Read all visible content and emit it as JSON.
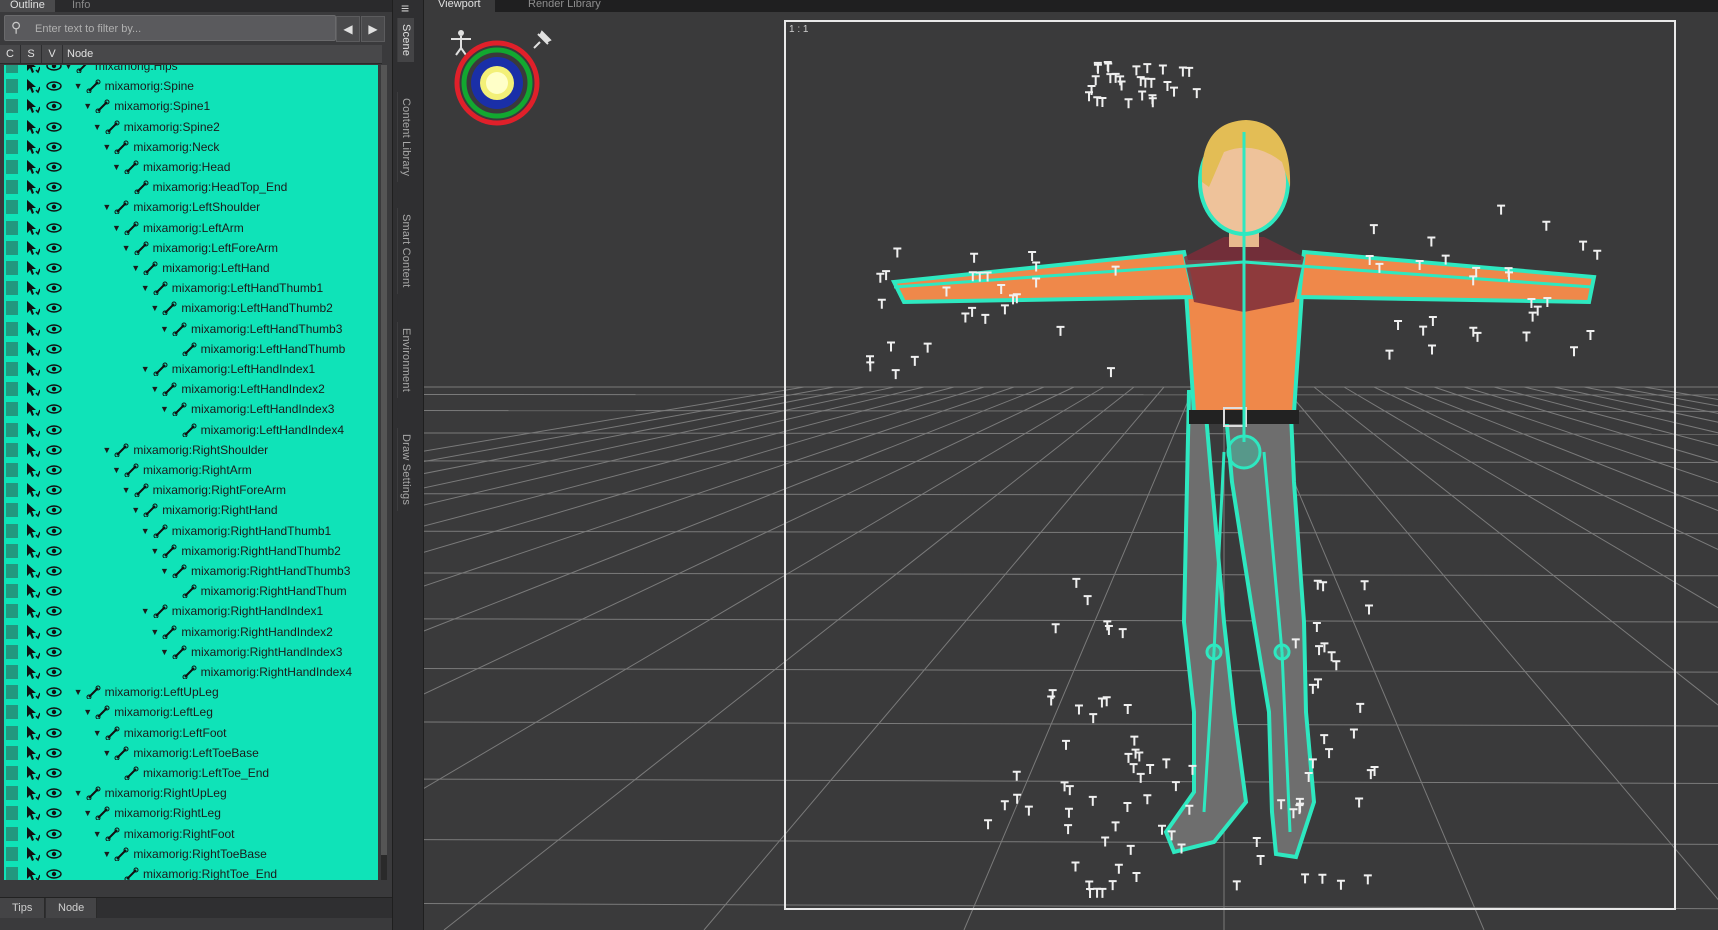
{
  "outline_panel": {
    "tabs": [
      {
        "label": "Outline",
        "active": true
      },
      {
        "label": "Info",
        "active": false
      }
    ],
    "filter": {
      "placeholder": "Enter text to filter by...",
      "value": ""
    },
    "nav_prev": "◀",
    "nav_next": "▶",
    "columns": [
      "C",
      "S",
      "V",
      "Node"
    ],
    "selection_color": "#0fe3b8",
    "nodes": [
      {
        "label": "mixamorig:Hips",
        "depth": 0,
        "expanded": true
      },
      {
        "label": "mixamorig:Spine",
        "depth": 1,
        "expanded": true
      },
      {
        "label": "mixamorig:Spine1",
        "depth": 2,
        "expanded": true
      },
      {
        "label": "mixamorig:Spine2",
        "depth": 3,
        "expanded": true
      },
      {
        "label": "mixamorig:Neck",
        "depth": 4,
        "expanded": true
      },
      {
        "label": "mixamorig:Head",
        "depth": 5,
        "expanded": true
      },
      {
        "label": "mixamorig:HeadTop_End",
        "depth": 6,
        "expanded": null
      },
      {
        "label": "mixamorig:LeftShoulder",
        "depth": 4,
        "expanded": true
      },
      {
        "label": "mixamorig:LeftArm",
        "depth": 5,
        "expanded": true
      },
      {
        "label": "mixamorig:LeftForeArm",
        "depth": 6,
        "expanded": true
      },
      {
        "label": "mixamorig:LeftHand",
        "depth": 7,
        "expanded": true
      },
      {
        "label": "mixamorig:LeftHandThumb1",
        "depth": 8,
        "expanded": true
      },
      {
        "label": "mixamorig:LeftHandThumb2",
        "depth": 9,
        "expanded": true
      },
      {
        "label": "mixamorig:LeftHandThumb3",
        "depth": 10,
        "expanded": true
      },
      {
        "label": "mixamorig:LeftHandThumb",
        "depth": 11,
        "expanded": null
      },
      {
        "label": "mixamorig:LeftHandIndex1",
        "depth": 8,
        "expanded": true
      },
      {
        "label": "mixamorig:LeftHandIndex2",
        "depth": 9,
        "expanded": true
      },
      {
        "label": "mixamorig:LeftHandIndex3",
        "depth": 10,
        "expanded": true
      },
      {
        "label": "mixamorig:LeftHandIndex4",
        "depth": 11,
        "expanded": null
      },
      {
        "label": "mixamorig:RightShoulder",
        "depth": 4,
        "expanded": true
      },
      {
        "label": "mixamorig:RightArm",
        "depth": 5,
        "expanded": true
      },
      {
        "label": "mixamorig:RightForeArm",
        "depth": 6,
        "expanded": true
      },
      {
        "label": "mixamorig:RightHand",
        "depth": 7,
        "expanded": true
      },
      {
        "label": "mixamorig:RightHandThumb1",
        "depth": 8,
        "expanded": true
      },
      {
        "label": "mixamorig:RightHandThumb2",
        "depth": 9,
        "expanded": true
      },
      {
        "label": "mixamorig:RightHandThumb3",
        "depth": 10,
        "expanded": true
      },
      {
        "label": "mixamorig:RightHandThum",
        "depth": 11,
        "expanded": null
      },
      {
        "label": "mixamorig:RightHandIndex1",
        "depth": 8,
        "expanded": true
      },
      {
        "label": "mixamorig:RightHandIndex2",
        "depth": 9,
        "expanded": true
      },
      {
        "label": "mixamorig:RightHandIndex3",
        "depth": 10,
        "expanded": true
      },
      {
        "label": "mixamorig:RightHandIndex4",
        "depth": 11,
        "expanded": null
      },
      {
        "label": "mixamorig:LeftUpLeg",
        "depth": 1,
        "expanded": true
      },
      {
        "label": "mixamorig:LeftLeg",
        "depth": 2,
        "expanded": true
      },
      {
        "label": "mixamorig:LeftFoot",
        "depth": 3,
        "expanded": true
      },
      {
        "label": "mixamorig:LeftToeBase",
        "depth": 4,
        "expanded": true
      },
      {
        "label": "mixamorig:LeftToe_End",
        "depth": 5,
        "expanded": null
      },
      {
        "label": "mixamorig:RightUpLeg",
        "depth": 1,
        "expanded": true
      },
      {
        "label": "mixamorig:RightLeg",
        "depth": 2,
        "expanded": true
      },
      {
        "label": "mixamorig:RightFoot",
        "depth": 3,
        "expanded": true
      },
      {
        "label": "mixamorig:RightToeBase",
        "depth": 4,
        "expanded": true
      },
      {
        "label": "mixamorig:RightToe_End",
        "depth": 5,
        "expanded": null
      }
    ],
    "bottom_tabs": [
      "Tips",
      "Node"
    ]
  },
  "side_tabs": [
    "Scene",
    "Content Library",
    "Smart Content",
    "Environment",
    "Draw Settings"
  ],
  "viewport": {
    "tabs": [
      {
        "label": "Viewport",
        "active": true
      },
      {
        "label": "Render Library",
        "active": false
      }
    ],
    "zoom_label": "1 : 1",
    "icons": [
      "pose-tool-icon",
      "navigation-cube-icon",
      "pin-icon"
    ],
    "colors": {
      "skeleton": "#2ee8c0",
      "shirt": "#f08a4b",
      "collar": "#8a2a3a",
      "pants": "#707070",
      "hair": "#e6c15a",
      "grid_bg": "#3a3a3b"
    }
  }
}
